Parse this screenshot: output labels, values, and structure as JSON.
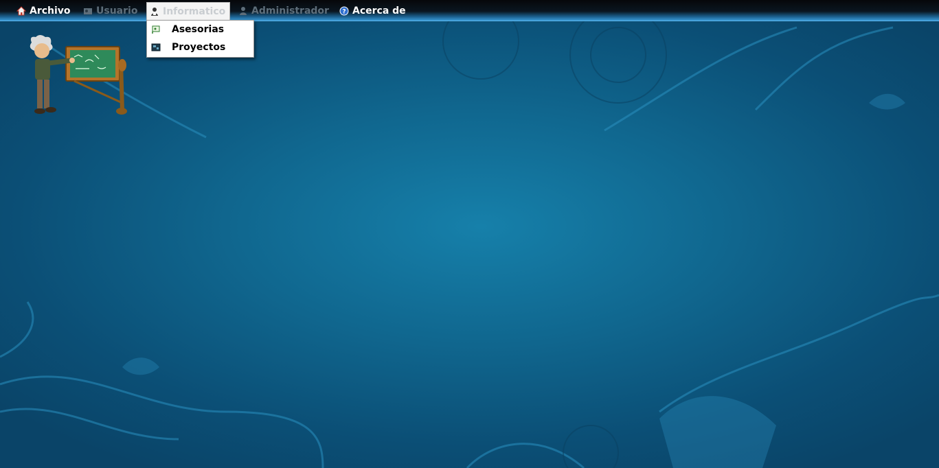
{
  "menubar": {
    "items": [
      {
        "label": "Archivo",
        "icon": "home-icon",
        "enabled": true
      },
      {
        "label": "Usuario",
        "icon": "user-card-icon",
        "enabled": false
      },
      {
        "label": "Informatico",
        "icon": "technician-icon",
        "enabled": true,
        "open": true
      },
      {
        "label": "Administrador",
        "icon": "admin-icon",
        "enabled": false
      },
      {
        "label": "Acerca de",
        "icon": "help-icon",
        "enabled": true
      }
    ]
  },
  "dropdown": {
    "items": [
      {
        "label": "Asesorias",
        "icon": "advice-icon"
      },
      {
        "label": "Proyectos",
        "icon": "projects-icon"
      }
    ]
  },
  "colors": {
    "background": "#10678f",
    "menubar_top": "#06070a",
    "menubar_bottom": "#3a9ad6",
    "disabled_text": "#5e6e7a",
    "dropdown_bg": "#ffffff"
  }
}
